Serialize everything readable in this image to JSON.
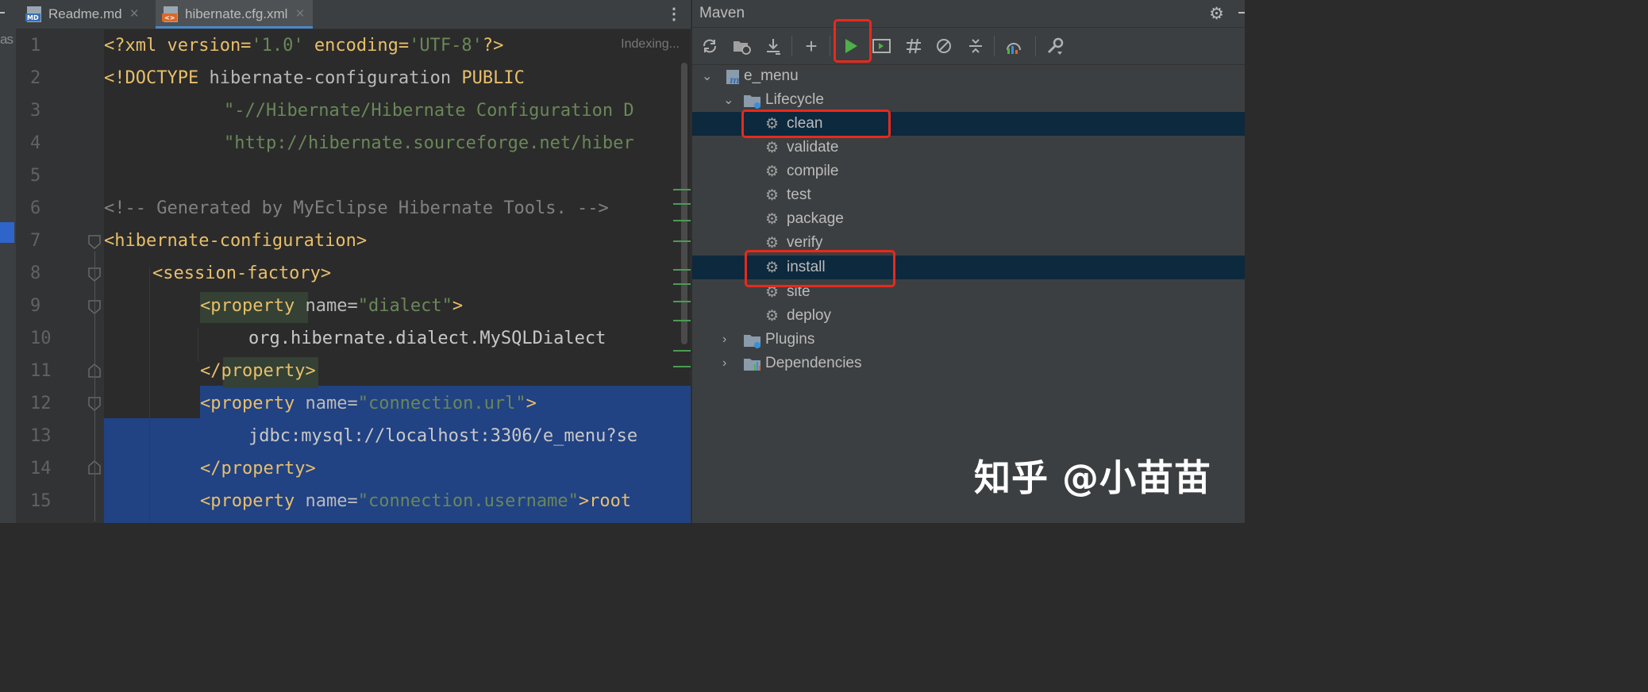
{
  "left_sliver": {
    "text": "as"
  },
  "tabs": [
    {
      "label": "Readme.md",
      "icon": "markdown-file-icon",
      "icon_text": "MD"
    },
    {
      "label": "hibernate.cfg.xml",
      "icon": "xml-file-icon",
      "icon_text": "<>"
    }
  ],
  "editor": {
    "status": "Indexing...",
    "line_numbers": [
      "1",
      "2",
      "3",
      "4",
      "5",
      "6",
      "7",
      "8",
      "9",
      "10",
      "11",
      "12",
      "13",
      "14",
      "15"
    ],
    "lines": {
      "l1": {
        "a": "<?xml version=",
        "b": "'1.0'",
        "c": " encoding=",
        "d": "'UTF-8'",
        "e": "?>"
      },
      "l2": {
        "a": "<!DOCTYPE ",
        "b": "hibernate-configuration ",
        "c": "PUBLIC"
      },
      "l3": "\"-//Hibernate/Hibernate Configuration D",
      "l4": "\"http://hibernate.sourceforge.net/hiber",
      "l6": "<!-- Generated by MyEclipse Hibernate Tools. -->",
      "l7": "<hibernate-configuration>",
      "l8": "<session-factory>",
      "l9": {
        "a": "<property",
        "b": " name=",
        "c": "\"dialect\"",
        "d": ">"
      },
      "l10": "org.hibernate.dialect.MySQLDialect",
      "l11": "</property>",
      "l12": {
        "a": "<property",
        "b": " name=",
        "c": "\"connection.url\"",
        "d": ">"
      },
      "l13": "jdbc:mysql://localhost:3306/e_menu?se",
      "l14": "</property>",
      "l15": {
        "a": "<property",
        "b": " name=",
        "c": "\"connection.username\"",
        "d": ">root"
      }
    }
  },
  "maven": {
    "title": "Maven",
    "toolbar": [
      {
        "name": "reload-icon",
        "glyph": "⟳"
      },
      {
        "name": "add-folder-icon",
        "glyph": "▣"
      },
      {
        "name": "download-icon",
        "glyph": "⤓"
      },
      {
        "name": "add-icon",
        "glyph": "+"
      },
      {
        "name": "run-icon",
        "glyph": "▶"
      },
      {
        "name": "execute-goal-icon",
        "glyph": "▭"
      },
      {
        "name": "toggle-offline-icon",
        "glyph": "⫽"
      },
      {
        "name": "skip-tests-icon",
        "glyph": "⊘"
      },
      {
        "name": "collapse-all-icon",
        "glyph": "⇕"
      },
      {
        "name": "dependency-analyzer-icon",
        "glyph": "◔"
      },
      {
        "name": "settings-wrench-icon",
        "glyph": "🔧"
      }
    ],
    "tree": {
      "project": "e_menu",
      "lifecycle": "Lifecycle",
      "goals": [
        "clean",
        "validate",
        "compile",
        "test",
        "package",
        "verify",
        "install",
        "site",
        "deploy"
      ],
      "plugins": "Plugins",
      "dependencies": "Dependencies"
    }
  },
  "watermark": "知乎 @小苗苗",
  "colors": {
    "highlight_box": "#e8291c",
    "selection": "#214283",
    "tree_selection": "#0d293e",
    "run_green": "#4eb04a"
  }
}
